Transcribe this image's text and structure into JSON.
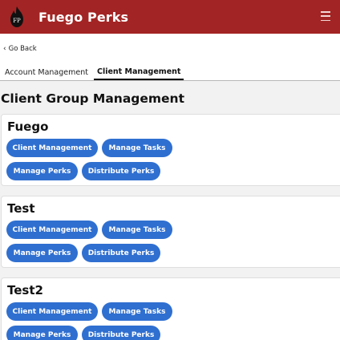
{
  "header": {
    "logo_text": "FP",
    "title": "Fuego Perks",
    "menu_icon": "hamburger-icon",
    "bg_color": "#a32424"
  },
  "nav": {
    "back_label": "Go Back",
    "back_icon": "chevron-left-icon"
  },
  "tabs": [
    {
      "label": "Account Management",
      "active": false
    },
    {
      "label": "Client Management",
      "active": true
    }
  ],
  "page_title": "Client Group Management",
  "accent_color": "#2f6fd0",
  "groups": [
    {
      "name": "Fuego",
      "buttons": [
        "Client Management",
        "Manage Tasks",
        "Manage Perks",
        "Distribute Perks"
      ]
    },
    {
      "name": "Test",
      "buttons": [
        "Client Management",
        "Manage Tasks",
        "Manage Perks",
        "Distribute Perks"
      ]
    },
    {
      "name": "Test2",
      "buttons": [
        "Client Management",
        "Manage Tasks",
        "Manage Perks",
        "Distribute Perks"
      ]
    }
  ]
}
